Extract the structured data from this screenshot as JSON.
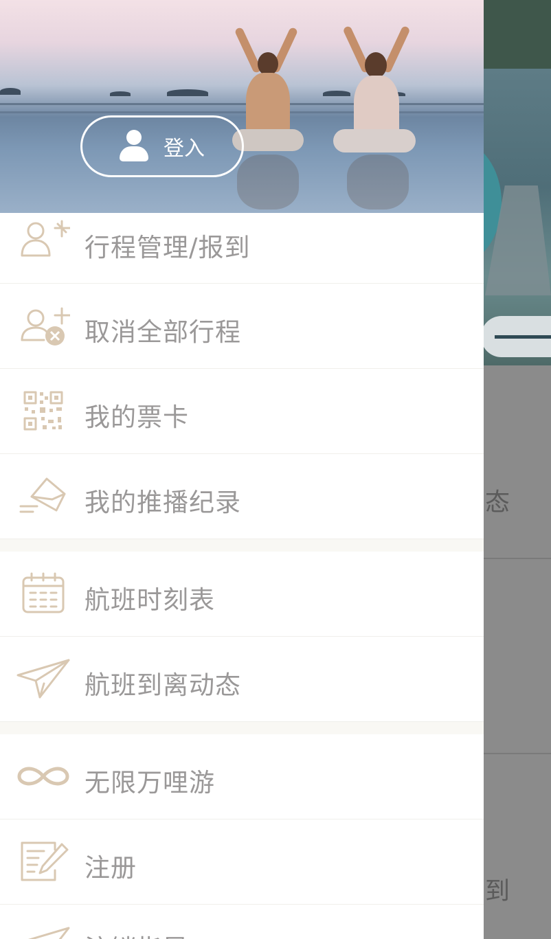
{
  "colors": {
    "icon_tan": "#d9c8b2",
    "menu_text": "#9a9898",
    "overlay": "#8b8b8b",
    "header_green": "#3f574b"
  },
  "login": {
    "label": "登入",
    "icon": "user-icon"
  },
  "menu": {
    "items": [
      {
        "label": "行程管理/报到",
        "icon": "itinerary-icon"
      },
      {
        "label": "取消全部行程",
        "icon": "cancel-itinerary-icon"
      },
      {
        "label": "我的票卡",
        "icon": "qr-code-icon"
      },
      {
        "label": "我的推播纪录",
        "icon": "envelope-icon"
      },
      {
        "label": "航班时刻表",
        "icon": "calendar-icon"
      },
      {
        "label": "航班到离动态",
        "icon": "paper-plane-icon"
      },
      {
        "label": "无限万哩游",
        "icon": "infinity-icon"
      },
      {
        "label": "注册",
        "icon": "edit-form-icon"
      },
      {
        "label": "注销指导",
        "icon": "paper-plane-icon"
      }
    ]
  },
  "background": {
    "partial_text_1": "态",
    "partial_text_2": "到"
  }
}
